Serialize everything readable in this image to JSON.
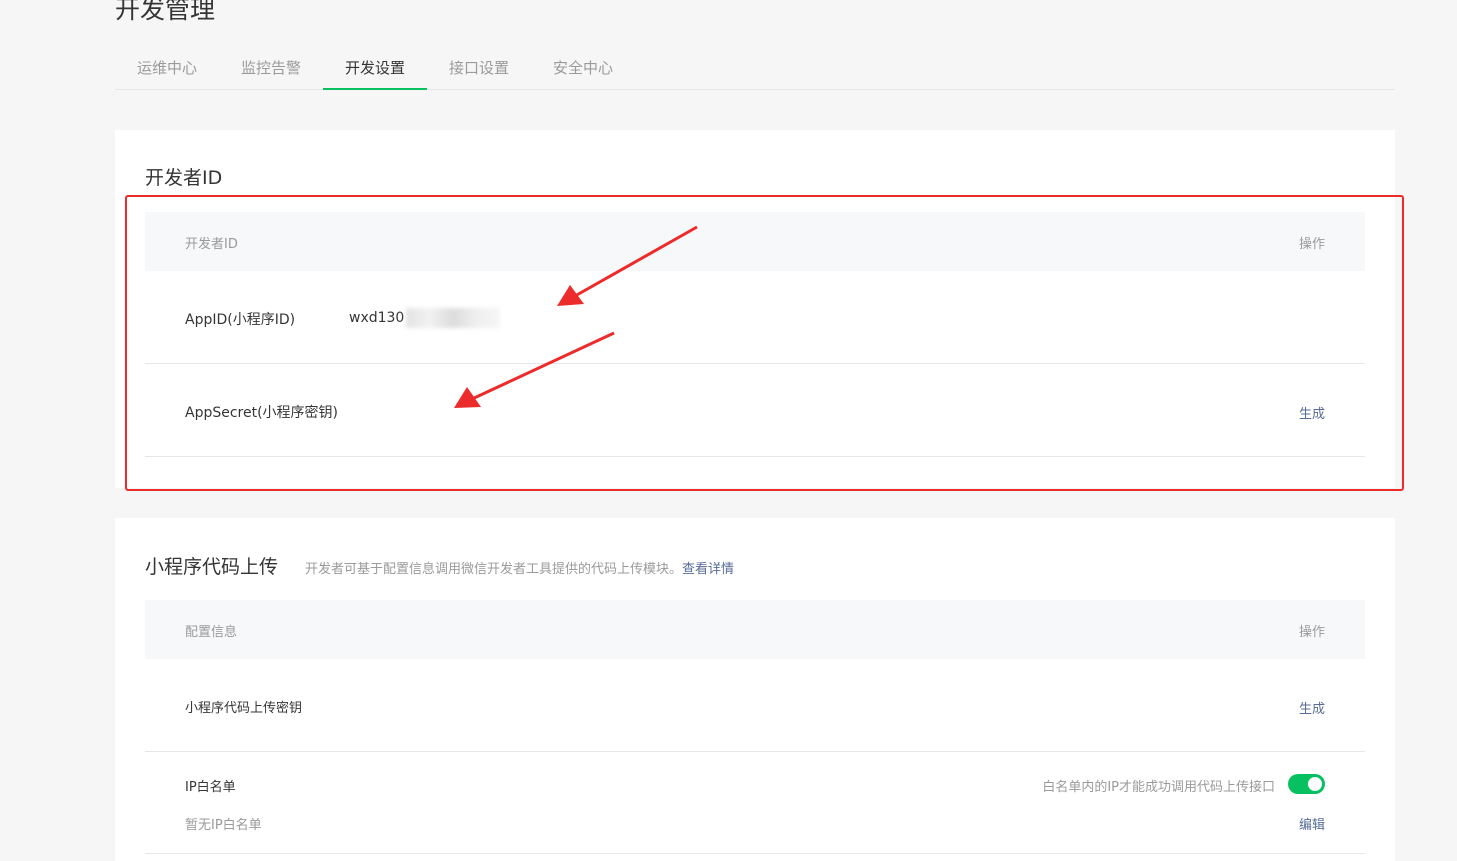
{
  "page": {
    "title": "开发管理"
  },
  "tabs": [
    {
      "label": "运维中心"
    },
    {
      "label": "监控告警"
    },
    {
      "label": "开发设置"
    },
    {
      "label": "接口设置"
    },
    {
      "label": "安全中心"
    }
  ],
  "developer_id": {
    "title": "开发者ID",
    "header": {
      "col1": "开发者ID",
      "col2": "操作"
    },
    "rows": [
      {
        "label": "AppID(小程序ID)",
        "value": "wxd130"
      },
      {
        "label": "AppSecret(小程序密钥)",
        "action": "生成"
      }
    ]
  },
  "code_upload": {
    "title": "小程序代码上传",
    "subtitle": "开发者可基于配置信息调用微信开发者工具提供的代码上传模块。",
    "subtitle_link": "查看详情",
    "header": {
      "col1": "配置信息",
      "col2": "操作"
    },
    "rows": [
      {
        "label": "小程序代码上传密钥",
        "action": "生成"
      },
      {
        "label": "IP白名单",
        "note": "白名单内的IP才能成功调用代码上传接口",
        "toggle_on": true,
        "sub_label": "暂无IP白名单",
        "action": "编辑"
      }
    ]
  },
  "colors": {
    "accent": "#07c160",
    "link": "#576b95",
    "annotation": "#ec2b2b"
  }
}
